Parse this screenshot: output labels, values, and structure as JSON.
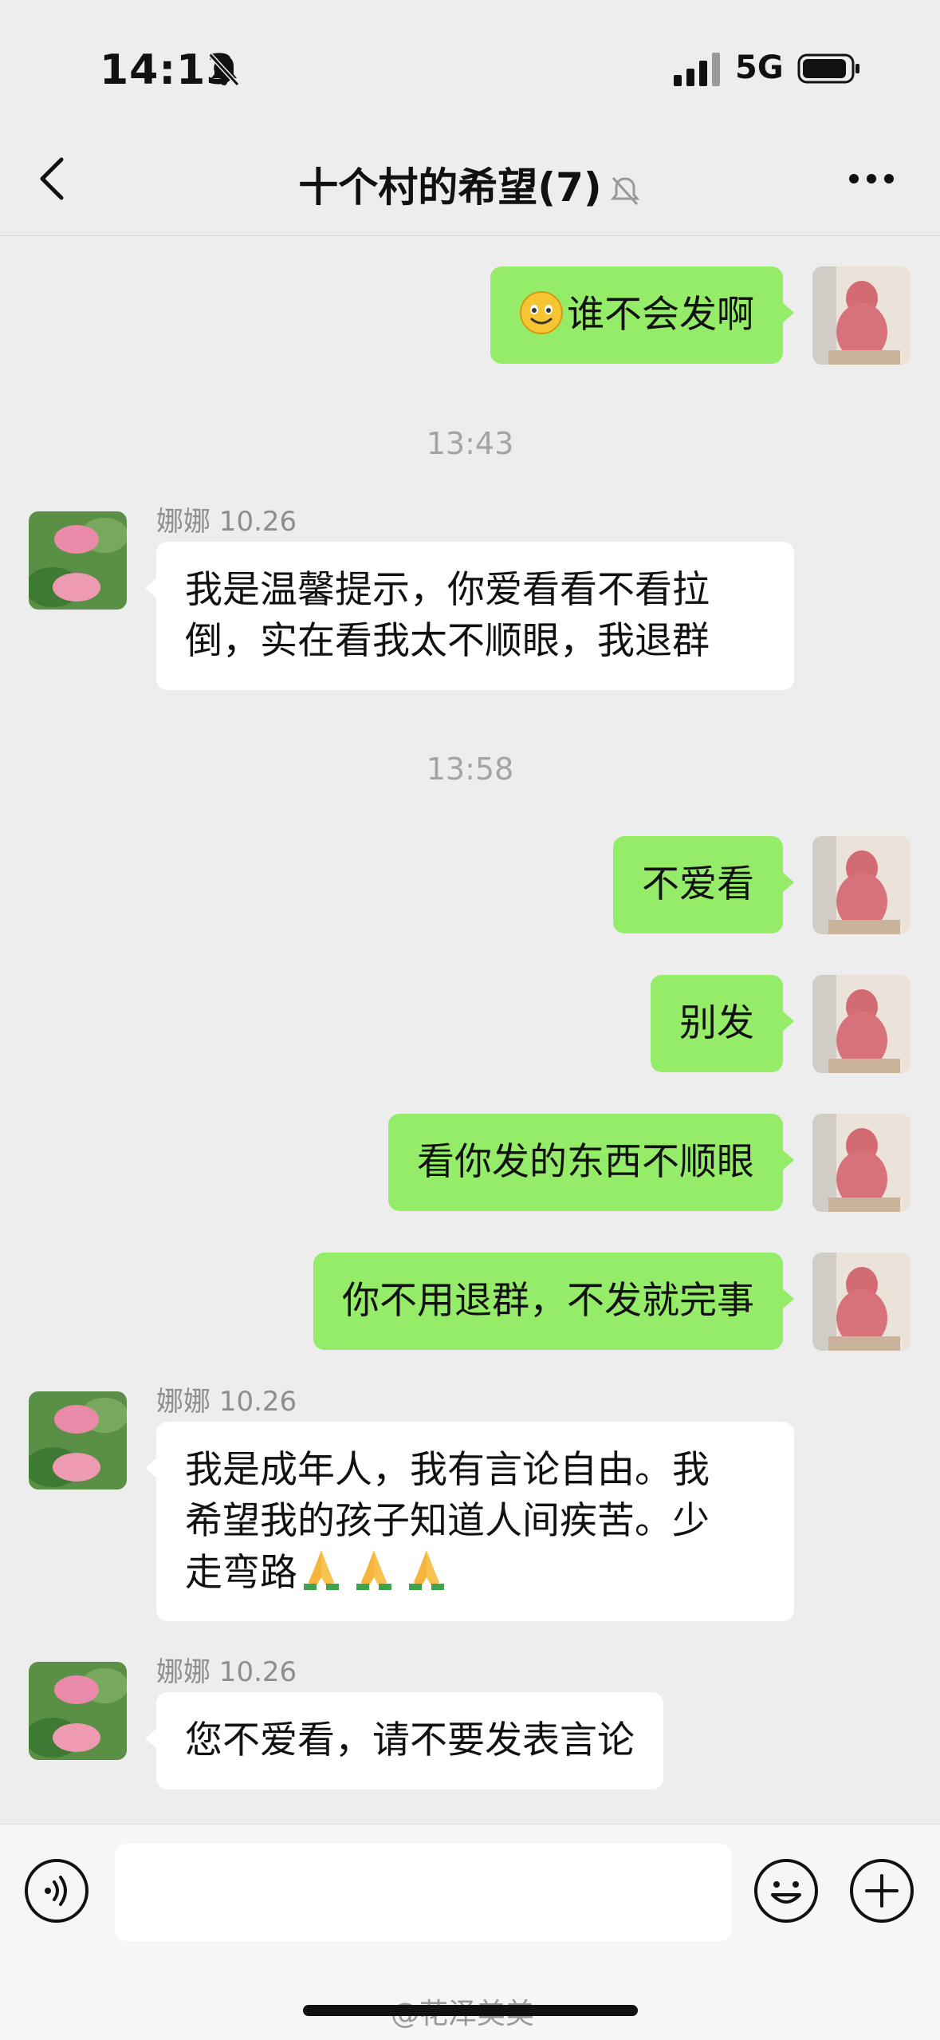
{
  "status_bar": {
    "time": "14:13",
    "network": "5G",
    "icons": [
      "bell-slash-icon",
      "signal-icon",
      "battery-icon"
    ]
  },
  "nav": {
    "title": "十个村的希望",
    "member_count": "(7)",
    "icons": [
      "back-arrow-icon",
      "mute-bell-icon",
      "more-icon"
    ]
  },
  "messages": {
    "m1": {
      "text": "谁不会发啊",
      "emoji": "smile-emoji"
    },
    "t1": "13:43",
    "m2": {
      "sender": "娜娜 10.26",
      "line1": "我是温馨提示，你爱看看不看拉",
      "line2": "倒，实在看我太不顺眼，我退群"
    },
    "t2": "13:58",
    "m3": {
      "text": "不爱看"
    },
    "m4": {
      "text": "别发"
    },
    "m5": {
      "text": "看你发的东西不顺眼"
    },
    "m6": {
      "text": "你不用退群，不发就完事"
    },
    "m7": {
      "sender": "娜娜 10.26",
      "line1": "我是成年人，我有言论自由。我",
      "line2": "希望我的孩子知道人间疾苦。少",
      "line3": "走弯路",
      "emoji": "pray-emoji x3"
    },
    "m8": {
      "sender": "娜娜 10.26",
      "text": "您不爱看，请不要发表言论"
    }
  },
  "input_bar": {
    "icons": [
      "voice-icon",
      "emoji-icon",
      "plus-icon"
    ]
  },
  "watermark": "@花泽美美",
  "colors": {
    "background": "#ededed",
    "outgoing_bubble": "#95ec69",
    "incoming_bubble": "#ffffff",
    "timestamp": "#a4a4a4"
  }
}
